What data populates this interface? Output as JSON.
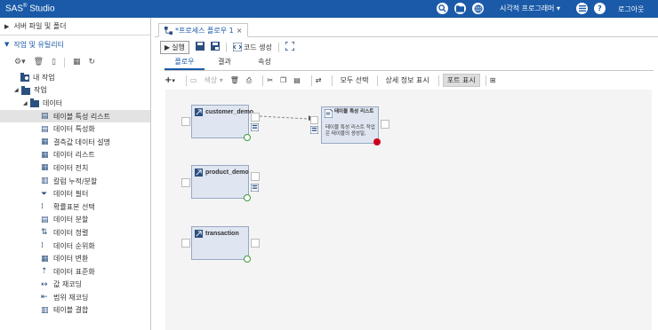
{
  "app": {
    "brand": "SAS",
    "brand_reg": "®",
    "brand_suffix": " Studio"
  },
  "topbar": {
    "perspective": "시각적 프로그래머",
    "perspective_caret": "▾",
    "logout": "로그아웃",
    "icons": [
      "search-icon",
      "open-folder-icon",
      "globe-icon",
      "menu-icon",
      "help-icon"
    ]
  },
  "left": {
    "sections": {
      "server": "서버 파일 및 폴더",
      "tasks": "작업 및 유틸리티"
    },
    "tree": {
      "my_tasks": "내 작업",
      "tasks": "작업",
      "data": "데이터",
      "items": [
        "테이블 특성 리스트",
        "데이터 특성화",
        "결측값 데이터 설명",
        "데이터 리스트",
        "데이터 전치",
        "칼럼 누적/분할",
        "데이터 필터",
        "확률표본 선택",
        "데이터 분할",
        "데이터 정렬",
        "데이터 순위화",
        "데이터 변환",
        "데이터 표준화",
        "값 재코딩",
        "범위 재코딩",
        "테이블 결합"
      ]
    }
  },
  "editor": {
    "doc_tab": "*프로세스 플로우 1",
    "doc_tab_close": "×",
    "run": "실행",
    "code_gen": "코드 생성",
    "subtabs": [
      "플로우",
      "결과",
      "속성"
    ],
    "style_label": "색상",
    "caret": "▾",
    "select_all": "모두 선택",
    "show_details": "상세 정보 표시",
    "show_ports": "포트 표시"
  },
  "flow": {
    "nodes": [
      "customer_demo",
      "product_demo",
      "transaction"
    ],
    "task_title": "테이블 특성 리스트",
    "task_desc": "테이블 특성 리스트 작업은 테이블의 생성일,"
  },
  "colors": {
    "brand_blue": "#1a5aa8",
    "node_fill": "#dfe6f1",
    "ok_green": "#3a9a3a",
    "error_red": "#d0021b"
  }
}
